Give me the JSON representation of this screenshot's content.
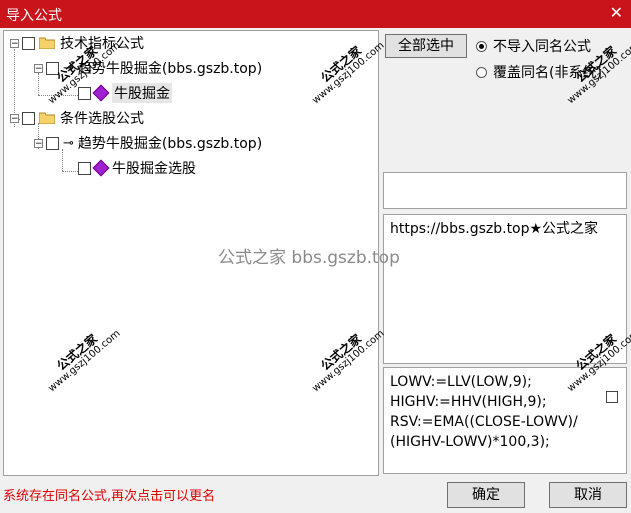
{
  "window": {
    "title": "导入公式",
    "close_glyph": "✕"
  },
  "tree": {
    "nodes": [
      {
        "label": "技术指标公式",
        "expander": "−"
      },
      {
        "label": "趋势牛股掘金(bbs.gszb.top)",
        "expander": "−"
      },
      {
        "label": "牛股掘金"
      },
      {
        "label": "条件选股公式",
        "expander": "−"
      },
      {
        "label": "趋势牛股掘金(bbs.gszb.top)",
        "expander": "−"
      },
      {
        "label": "牛股掘金选股"
      }
    ]
  },
  "buttons": {
    "select_all": "全部选中",
    "ok": "确定",
    "cancel": "取消"
  },
  "options": {
    "no_import_same_name": "不导入同名公式",
    "overwrite_same_name": "覆盖同名(非系统)"
  },
  "info_text": "https://bbs.gszb.top★公式之家",
  "formula_text": "LOWV:=LLV(LOW,9);\nHIGHV:=HHV(HIGH,9);\nRSV:=EMA((CLOSE-LOWV)/\n(HIGHV-LOWV)*100,3);",
  "status_message": "系统存在同名公式,再次点击可以更名",
  "watermarks": {
    "big": "公式之家",
    "small": "www.gszj100.com",
    "center": "公式之家 bbs.gszb.top"
  },
  "colors": {
    "titlebar": "#c9141b",
    "status": "#e00000",
    "gem": "#a020d0",
    "folder": "#f5d36a"
  }
}
